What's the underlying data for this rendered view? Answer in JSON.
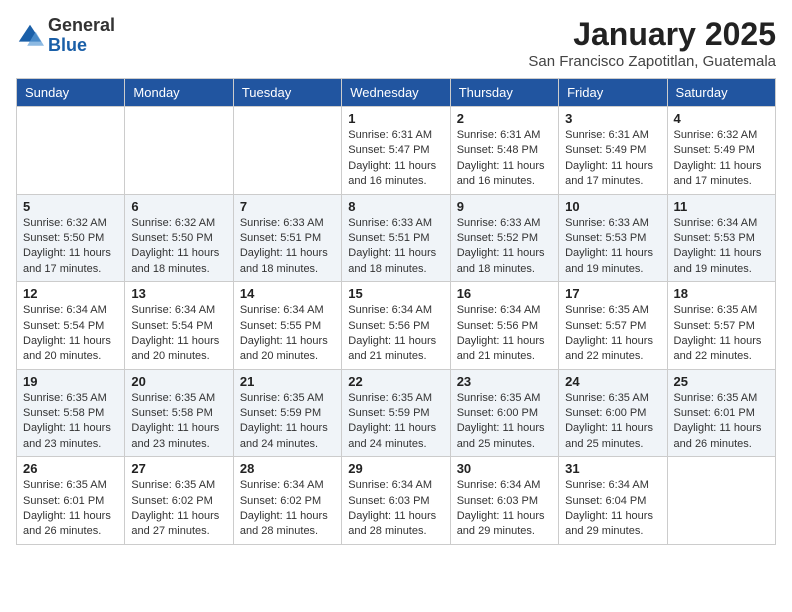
{
  "logo": {
    "general": "General",
    "blue": "Blue"
  },
  "header": {
    "month_year": "January 2025",
    "location": "San Francisco Zapotitlan, Guatemala"
  },
  "days_of_week": [
    "Sunday",
    "Monday",
    "Tuesday",
    "Wednesday",
    "Thursday",
    "Friday",
    "Saturday"
  ],
  "weeks": [
    [
      {
        "day": "",
        "info": ""
      },
      {
        "day": "",
        "info": ""
      },
      {
        "day": "",
        "info": ""
      },
      {
        "day": "1",
        "info": "Sunrise: 6:31 AM\nSunset: 5:47 PM\nDaylight: 11 hours\nand 16 minutes."
      },
      {
        "day": "2",
        "info": "Sunrise: 6:31 AM\nSunset: 5:48 PM\nDaylight: 11 hours\nand 16 minutes."
      },
      {
        "day": "3",
        "info": "Sunrise: 6:31 AM\nSunset: 5:49 PM\nDaylight: 11 hours\nand 17 minutes."
      },
      {
        "day": "4",
        "info": "Sunrise: 6:32 AM\nSunset: 5:49 PM\nDaylight: 11 hours\nand 17 minutes."
      }
    ],
    [
      {
        "day": "5",
        "info": "Sunrise: 6:32 AM\nSunset: 5:50 PM\nDaylight: 11 hours\nand 17 minutes."
      },
      {
        "day": "6",
        "info": "Sunrise: 6:32 AM\nSunset: 5:50 PM\nDaylight: 11 hours\nand 18 minutes."
      },
      {
        "day": "7",
        "info": "Sunrise: 6:33 AM\nSunset: 5:51 PM\nDaylight: 11 hours\nand 18 minutes."
      },
      {
        "day": "8",
        "info": "Sunrise: 6:33 AM\nSunset: 5:51 PM\nDaylight: 11 hours\nand 18 minutes."
      },
      {
        "day": "9",
        "info": "Sunrise: 6:33 AM\nSunset: 5:52 PM\nDaylight: 11 hours\nand 18 minutes."
      },
      {
        "day": "10",
        "info": "Sunrise: 6:33 AM\nSunset: 5:53 PM\nDaylight: 11 hours\nand 19 minutes."
      },
      {
        "day": "11",
        "info": "Sunrise: 6:34 AM\nSunset: 5:53 PM\nDaylight: 11 hours\nand 19 minutes."
      }
    ],
    [
      {
        "day": "12",
        "info": "Sunrise: 6:34 AM\nSunset: 5:54 PM\nDaylight: 11 hours\nand 20 minutes."
      },
      {
        "day": "13",
        "info": "Sunrise: 6:34 AM\nSunset: 5:54 PM\nDaylight: 11 hours\nand 20 minutes."
      },
      {
        "day": "14",
        "info": "Sunrise: 6:34 AM\nSunset: 5:55 PM\nDaylight: 11 hours\nand 20 minutes."
      },
      {
        "day": "15",
        "info": "Sunrise: 6:34 AM\nSunset: 5:56 PM\nDaylight: 11 hours\nand 21 minutes."
      },
      {
        "day": "16",
        "info": "Sunrise: 6:34 AM\nSunset: 5:56 PM\nDaylight: 11 hours\nand 21 minutes."
      },
      {
        "day": "17",
        "info": "Sunrise: 6:35 AM\nSunset: 5:57 PM\nDaylight: 11 hours\nand 22 minutes."
      },
      {
        "day": "18",
        "info": "Sunrise: 6:35 AM\nSunset: 5:57 PM\nDaylight: 11 hours\nand 22 minutes."
      }
    ],
    [
      {
        "day": "19",
        "info": "Sunrise: 6:35 AM\nSunset: 5:58 PM\nDaylight: 11 hours\nand 23 minutes."
      },
      {
        "day": "20",
        "info": "Sunrise: 6:35 AM\nSunset: 5:58 PM\nDaylight: 11 hours\nand 23 minutes."
      },
      {
        "day": "21",
        "info": "Sunrise: 6:35 AM\nSunset: 5:59 PM\nDaylight: 11 hours\nand 24 minutes."
      },
      {
        "day": "22",
        "info": "Sunrise: 6:35 AM\nSunset: 5:59 PM\nDaylight: 11 hours\nand 24 minutes."
      },
      {
        "day": "23",
        "info": "Sunrise: 6:35 AM\nSunset: 6:00 PM\nDaylight: 11 hours\nand 25 minutes."
      },
      {
        "day": "24",
        "info": "Sunrise: 6:35 AM\nSunset: 6:00 PM\nDaylight: 11 hours\nand 25 minutes."
      },
      {
        "day": "25",
        "info": "Sunrise: 6:35 AM\nSunset: 6:01 PM\nDaylight: 11 hours\nand 26 minutes."
      }
    ],
    [
      {
        "day": "26",
        "info": "Sunrise: 6:35 AM\nSunset: 6:01 PM\nDaylight: 11 hours\nand 26 minutes."
      },
      {
        "day": "27",
        "info": "Sunrise: 6:35 AM\nSunset: 6:02 PM\nDaylight: 11 hours\nand 27 minutes."
      },
      {
        "day": "28",
        "info": "Sunrise: 6:34 AM\nSunset: 6:02 PM\nDaylight: 11 hours\nand 28 minutes."
      },
      {
        "day": "29",
        "info": "Sunrise: 6:34 AM\nSunset: 6:03 PM\nDaylight: 11 hours\nand 28 minutes."
      },
      {
        "day": "30",
        "info": "Sunrise: 6:34 AM\nSunset: 6:03 PM\nDaylight: 11 hours\nand 29 minutes."
      },
      {
        "day": "31",
        "info": "Sunrise: 6:34 AM\nSunset: 6:04 PM\nDaylight: 11 hours\nand 29 minutes."
      },
      {
        "day": "",
        "info": ""
      }
    ]
  ]
}
